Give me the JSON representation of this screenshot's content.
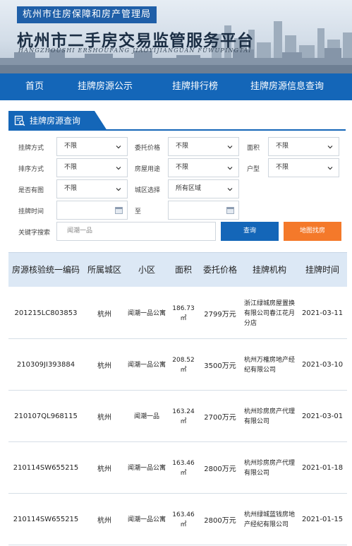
{
  "header": {
    "agency": "杭州市住房保障和房产管理局",
    "title": "杭州市二手房交易监管服务平台",
    "pinyin": "HANGZHOUSHI ERSHOUFANG JIAOYIJIANGUAN FUWUPINGTAI"
  },
  "nav": {
    "items": [
      "首页",
      "挂牌房源公示",
      "挂牌排行榜",
      "挂牌房源信息查询"
    ]
  },
  "section": {
    "title": "挂牌房源查询"
  },
  "form": {
    "listing_method": {
      "label": "挂牌方式",
      "value": "不限"
    },
    "entrusted_price": {
      "label": "委托价格",
      "value": "不限"
    },
    "area": {
      "label": "面积",
      "value": "不限"
    },
    "sort_method": {
      "label": "排序方式",
      "value": "不限"
    },
    "house_use": {
      "label": "房屋用途",
      "value": "不限"
    },
    "layout": {
      "label": "户型",
      "value": "不限"
    },
    "has_image": {
      "label": "是否有图",
      "value": "不限"
    },
    "district": {
      "label": "城区选择",
      "value": "所有区域"
    },
    "listing_time": {
      "label": "挂牌时间",
      "to_label": "至"
    },
    "keyword": {
      "label": "关键字搜索",
      "value": "闻潮一品"
    },
    "query_label": "查询",
    "map_label": "地图找房"
  },
  "table": {
    "headers": [
      "房源核验统一编码",
      "所属城区",
      "小区",
      "面积",
      "委托价格",
      "挂牌机构",
      "挂牌时间"
    ],
    "rows": [
      {
        "code": "201215LC803853",
        "district": "杭州",
        "community": "闻潮一品公寓",
        "area": "186.73",
        "unit": "㎡",
        "price": "2799万元",
        "agency": "浙江绿城房屋置换有限公司春江花月分店",
        "date": "2021-03-11"
      },
      {
        "code": "210309JI393884",
        "district": "杭州",
        "community": "闻潮一品公寓",
        "area": "208.52",
        "unit": "㎡",
        "price": "3500万元",
        "agency": "杭州万榷房地产经纪有限公司",
        "date": "2021-03-10"
      },
      {
        "code": "210107QL968115",
        "district": "杭州",
        "community": "闻潮一品",
        "area": "163.24",
        "unit": "㎡",
        "price": "2700万元",
        "agency": "杭州珍房房产代理有限公司",
        "date": "2021-03-01"
      },
      {
        "code": "210114SW655215",
        "district": "杭州",
        "community": "闻潮一品公寓",
        "area": "163.46",
        "unit": "㎡",
        "price": "2800万元",
        "agency": "杭州珍房房产代理有限公司",
        "date": "2021-01-18"
      },
      {
        "code": "210114SW655215",
        "district": "杭州",
        "community": "闻潮一品公寓",
        "area": "163.46",
        "unit": "㎡",
        "price": "2800万元",
        "agency": "杭州绿城蓝钱房地产经纪有限公司",
        "date": "2021-01-15"
      }
    ]
  },
  "colors": {
    "brand_blue": "#1466b8",
    "orange": "#f4792a",
    "header_bg": "#dce8f5"
  }
}
